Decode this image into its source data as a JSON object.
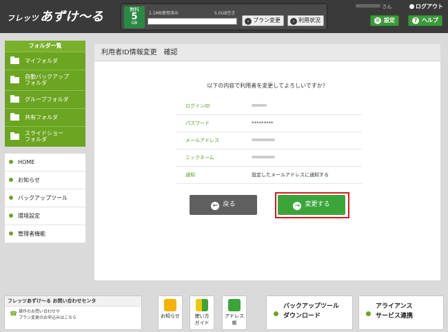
{
  "header": {
    "logo_small": "フレッツ",
    "logo_main": "あずけ〜る",
    "plan": {
      "label": "無料",
      "size": "5",
      "unit": "GB"
    },
    "used": "1.1MB使用済み",
    "free": "5.0GB空き",
    "usage_fraction": 0.0002,
    "plan_change_label": "プラン変更",
    "usage_status_label": "利用状況",
    "user_suffix": "さん",
    "logout_label": "ログアウト",
    "settings_label": "設定",
    "help_label": "ヘルプ"
  },
  "sidebar": {
    "folder_title": "フォルダ一覧",
    "folders": [
      {
        "label": "マイフォルダ"
      },
      {
        "label": "自動バックアップ",
        "label2": "フォルダ"
      },
      {
        "label": "グループフォルダ"
      },
      {
        "label": "共有フォルダ"
      },
      {
        "label": "スライドショー",
        "label2": "フォルダ"
      }
    ],
    "nav": [
      {
        "label": "HOME"
      },
      {
        "label": "お知らせ"
      },
      {
        "label": "バックアップツール"
      },
      {
        "label": "環境設定"
      },
      {
        "label": "管理者機能"
      }
    ]
  },
  "main": {
    "title": "利用者ID情報変更　確認",
    "question": "以下の内容で利用者を変更してよろしいですか？",
    "fields": [
      {
        "label": "ログインID",
        "value": ""
      },
      {
        "label": "パスワード",
        "value": "*********"
      },
      {
        "label": "メールアドレス",
        "value": ""
      },
      {
        "label": "ニックネーム",
        "value": ""
      },
      {
        "label": "通知",
        "value": "設定したメールアドレスに通知する"
      }
    ],
    "back_label": "戻る",
    "change_label": "変更する"
  },
  "footer": {
    "contact_title": "フレッツあずけ〜る お問い合わせセンタ",
    "contact_line1": "操作のお問い合わせや",
    "contact_line2": "プラン変更のお申込みはこちら",
    "news_label": "お知らせ",
    "guide_label1": "使い方",
    "guide_label2": "ガイド",
    "address_label1": "アドレス",
    "address_label2": "帳",
    "backup_tool_line1": "バックアップツール",
    "backup_tool_line2": "ダウンロード",
    "alliance_line1": "アライアンス",
    "alliance_line2": "サービス連携"
  }
}
